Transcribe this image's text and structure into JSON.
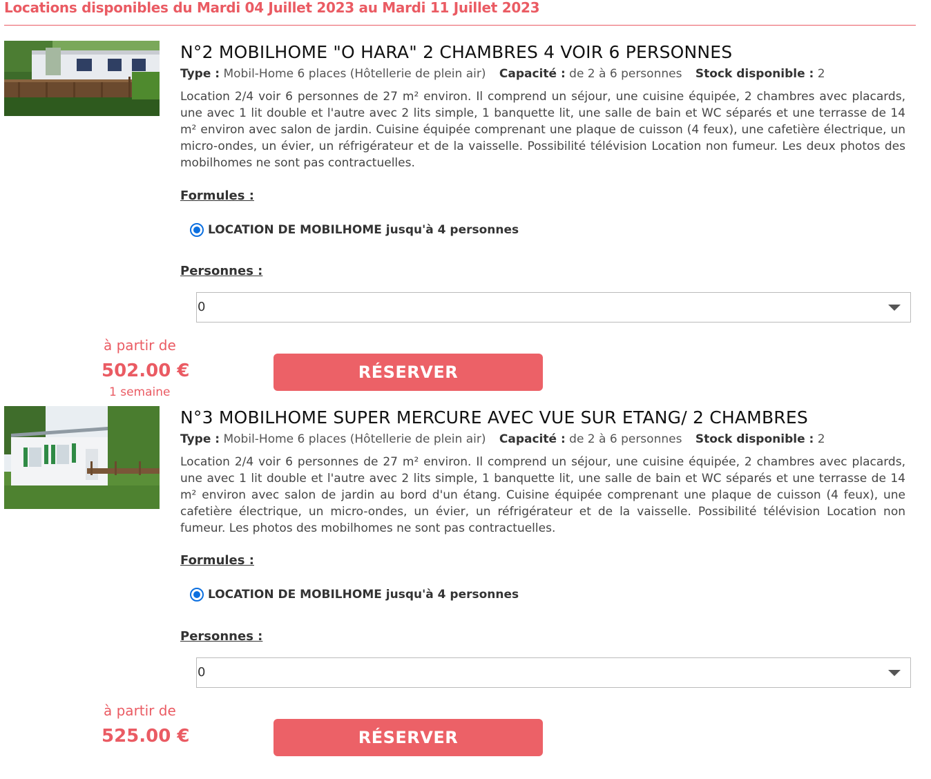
{
  "page": {
    "heading": "Locations disponibles du Mardi 04 Juillet 2023 au Mardi 11 Juillet 2023"
  },
  "listings": [
    {
      "title": "N°2 MOBILHOME \"O HARA\" 2 CHAMBRES 4 VOIR 6 PERSONNES",
      "type_label": "Type :",
      "type_value": "Mobil-Home 6 places (Hôtellerie de plein air)",
      "capacity_label": "Capacité :",
      "capacity_value": "de 2 à 6 personnes",
      "stock_label": "Stock disponible :",
      "stock_value": "2",
      "description": "Location 2/4 voir 6 personnes de 27 m² environ. Il comprend un séjour, une cuisine équipée, 2 chambres avec placards, une avec 1 lit double et l'autre avec 2 lits simple, 1 banquette lit, une salle de bain et WC séparés et une terrasse de 14 m² environ avec salon de jardin. Cuisine équipée comprenant une plaque de cuisson (4 feux), une cafetière électrique, un micro-ondes, un évier, un réfrigérateur et de la vaisselle. Possibilité télévision Location non fumeur. Les deux photos des mobilhomes ne sont pas contractuelles.",
      "formulas_label": "Formules :",
      "formula_option": "LOCATION DE MOBILHOME jusqu'à 4 personnes",
      "formula_selected": true,
      "persons_label": "Personnes :",
      "persons_value": "0",
      "price_prefix": "à partir de",
      "price": "502.00 €",
      "price_unit": "1 semaine",
      "reserve_label": "RÉSERVER"
    },
    {
      "title": "N°3 MOBILHOME SUPER MERCURE AVEC VUE SUR ETANG/ 2 CHAMBRES",
      "type_label": "Type :",
      "type_value": "Mobil-Home 6 places (Hôtellerie de plein air)",
      "capacity_label": "Capacité :",
      "capacity_value": "de 2 à 6 personnes",
      "stock_label": "Stock disponible :",
      "stock_value": "2",
      "description": "Location 2/4 voir 6 personnes de 27 m² environ. Il comprend un séjour, une cuisine équipée, 2 chambres avec placards, une avec 1 lit double et l'autre avec 2 lits simple, 1 banquette lit, une salle de bain et WC séparés et une terrasse de 14 m² environ avec salon de jardin au bord d'un étang. Cuisine équipée comprenant une plaque de cuisson (4 feux), une cafetière électrique, un micro-ondes, un évier, un réfrigérateur et de la vaisselle. Possibilité télévision Location non fumeur. Les photos des mobilhomes ne sont pas contractuelles.",
      "formulas_label": "Formules :",
      "formula_option": "LOCATION DE MOBILHOME jusqu'à 4 personnes",
      "formula_selected": true,
      "persons_label": "Personnes :",
      "persons_value": "0",
      "price_prefix": "à partir de",
      "price": "525.00 €",
      "reserve_label": "RÉSERVER"
    }
  ]
}
